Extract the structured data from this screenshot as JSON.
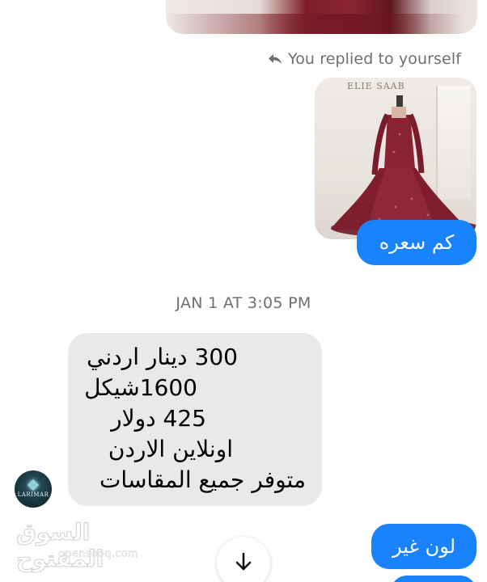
{
  "conversation": {
    "reply_indicator": "You replied to yourself",
    "outgoing_price_question": "كم سعره",
    "timestamp": "JAN 1 AT 3:05 PM",
    "incoming_message_lines": [
      "300 دينار اردني",
      "1600شيكل",
      "425 دولار",
      "اونلاين الاردن",
      "متوفر جميع المقاسات"
    ],
    "outgoing_color_question": "لون غير",
    "dress_photo_brand": "ELIE SAAB"
  },
  "avatar": {
    "label": "LARIMAR"
  },
  "watermark": {
    "arabic": "السوق المفتوح",
    "latin": "opensooq.com"
  },
  "icons": {
    "reply": "reply-arrow-icon",
    "scroll_down": "arrow-down-icon"
  },
  "colors": {
    "outgoing_bubble": "#1a82fb",
    "incoming_bubble": "#e9e9eb",
    "meta_text": "#6e6e73"
  }
}
